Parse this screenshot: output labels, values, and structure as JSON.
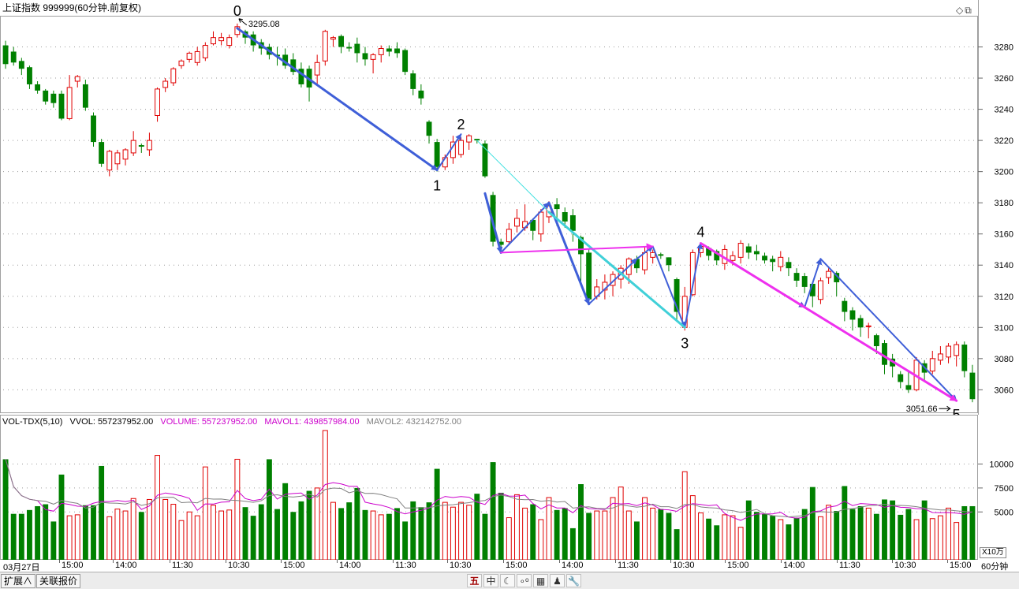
{
  "header": {
    "title": "上证指数 999999(60分钟.前复权)",
    "icons": [
      "diamond-icon",
      "restore-window-icon"
    ]
  },
  "chart_data": [
    {
      "type": "candlestick",
      "title": "上证指数 999999(60分钟.前复权)",
      "ylim": [
        3045,
        3300
      ],
      "yticks": [
        3060,
        3080,
        3100,
        3120,
        3140,
        3160,
        3180,
        3200,
        3220,
        3240,
        3260,
        3280
      ],
      "grid": true,
      "up_color": "#e00000",
      "down_color": "#008000",
      "candles": [
        [
          3281,
          3269,
          3284,
          3266
        ],
        [
          3277,
          3270,
          3280,
          3268
        ],
        [
          3271,
          3266,
          3273,
          3262
        ],
        [
          3267,
          3256,
          3268,
          3253
        ],
        [
          3256,
          3252,
          3258,
          3250
        ],
        [
          3252,
          3245,
          3253,
          3243
        ],
        [
          3250,
          3244,
          3252,
          3241
        ],
        [
          3250,
          3234,
          3252,
          3233
        ],
        [
          3234,
          3254,
          3262,
          3233
        ],
        [
          3258,
          3261,
          3262,
          3254
        ],
        [
          3256,
          3241,
          3259,
          3239
        ],
        [
          3236,
          3219,
          3238,
          3216
        ],
        [
          3219,
          3205,
          3221,
          3203
        ],
        [
          3201,
          3213,
          3214,
          3197
        ],
        [
          3205,
          3212,
          3214,
          3201
        ],
        [
          3208,
          3214,
          3215,
          3204
        ],
        [
          3212,
          3220,
          3226,
          3210
        ],
        [
          3217,
          3216,
          3218,
          3212
        ],
        [
          3214,
          3220,
          3225,
          3210
        ],
        [
          3236,
          3253,
          3254,
          3232
        ],
        [
          3254,
          3258,
          3260,
          3251
        ],
        [
          3257,
          3266,
          3267,
          3255
        ],
        [
          3268,
          3271,
          3272,
          3266
        ],
        [
          3272,
          3276,
          3277,
          3270
        ],
        [
          3270,
          3277,
          3280,
          3268
        ],
        [
          3273,
          3281,
          3283,
          3271
        ],
        [
          3282,
          3286,
          3290,
          3281
        ],
        [
          3284,
          3286,
          3289,
          3281
        ],
        [
          3281,
          3286,
          3288,
          3279
        ],
        [
          3288,
          3293,
          3295,
          3286
        ],
        [
          3290,
          3286,
          3291,
          3282
        ],
        [
          3288,
          3281,
          3290,
          3277
        ],
        [
          3283,
          3279,
          3285,
          3275
        ],
        [
          3280,
          3275,
          3282,
          3272
        ],
        [
          3275,
          3274,
          3280,
          3268
        ],
        [
          3275,
          3268,
          3279,
          3266
        ],
        [
          3272,
          3264,
          3276,
          3262
        ],
        [
          3266,
          3256,
          3270,
          3254
        ],
        [
          3266,
          3254,
          3268,
          3245
        ],
        [
          3262,
          3270,
          3275,
          3255
        ],
        [
          3271,
          3290,
          3291,
          3268
        ],
        [
          3285,
          3286,
          3287,
          3280
        ],
        [
          3287,
          3280,
          3288,
          3276
        ],
        [
          3280,
          3279,
          3283,
          3277
        ],
        [
          3282,
          3276,
          3286,
          3270
        ],
        [
          3276,
          3272,
          3280,
          3268
        ],
        [
          3272,
          3275,
          3276,
          3263
        ],
        [
          3275,
          3279,
          3281,
          3270
        ],
        [
          3279,
          3277,
          3281,
          3274
        ],
        [
          3279,
          3276,
          3283,
          3273
        ],
        [
          3278,
          3264,
          3279,
          3262
        ],
        [
          3263,
          3253,
          3265,
          3249
        ],
        [
          3252,
          3247,
          3256,
          3243
        ],
        [
          3232,
          3223,
          3233,
          3218
        ],
        [
          3219,
          3203,
          3221,
          3200
        ],
        [
          3203,
          3209,
          3211,
          3201
        ],
        [
          3209,
          3219,
          3223,
          3205
        ],
        [
          3211,
          3220,
          3222,
          3209
        ],
        [
          3219,
          3223,
          3224,
          3214
        ],
        [
          3221,
          3220,
          3221,
          3218
        ],
        [
          3218,
          3197,
          3220,
          3196
        ],
        [
          3185,
          3155,
          3187,
          3152
        ],
        [
          3155,
          3153,
          3157,
          3150
        ],
        [
          3155,
          3163,
          3167,
          3153
        ],
        [
          3165,
          3170,
          3176,
          3161
        ],
        [
          3164,
          3168,
          3179,
          3162
        ],
        [
          3169,
          3162,
          3170,
          3156
        ],
        [
          3160,
          3174,
          3176,
          3155
        ],
        [
          3171,
          3178,
          3181,
          3167
        ],
        [
          3179,
          3176,
          3183,
          3165
        ],
        [
          3174,
          3168,
          3177,
          3164
        ],
        [
          3172,
          3162,
          3176,
          3155
        ],
        [
          3158,
          3147,
          3159,
          3128
        ],
        [
          3148,
          3118,
          3150,
          3115
        ],
        [
          3120,
          3126,
          3131,
          3118
        ],
        [
          3124,
          3129,
          3134,
          3118
        ],
        [
          3127,
          3134,
          3136,
          3120
        ],
        [
          3131,
          3138,
          3140,
          3125
        ],
        [
          3134,
          3144,
          3145,
          3128
        ],
        [
          3144,
          3138,
          3146,
          3135
        ],
        [
          3137,
          3148,
          3152,
          3134
        ],
        [
          3145,
          3148,
          3150,
          3141
        ],
        [
          3147,
          3146,
          3148,
          3144
        ],
        [
          3145,
          3140,
          3145,
          3136
        ],
        [
          3131,
          3110,
          3132,
          3104
        ],
        [
          3100,
          3120,
          3126,
          3098
        ],
        [
          3121,
          3148,
          3150,
          3120
        ],
        [
          3148,
          3152,
          3154,
          3145
        ],
        [
          3151,
          3146,
          3152,
          3143
        ],
        [
          3149,
          3143,
          3150,
          3140
        ],
        [
          3141,
          3150,
          3153,
          3137
        ],
        [
          3143,
          3146,
          3149,
          3140
        ],
        [
          3145,
          3154,
          3156,
          3141
        ],
        [
          3152,
          3148,
          3154,
          3144
        ],
        [
          3149,
          3147,
          3153,
          3143
        ],
        [
          3146,
          3143,
          3148,
          3141
        ],
        [
          3144,
          3142,
          3146,
          3136
        ],
        [
          3139,
          3145,
          3149,
          3136
        ],
        [
          3142,
          3138,
          3145,
          3133
        ],
        [
          3135,
          3130,
          3138,
          3126
        ],
        [
          3133,
          3126,
          3135,
          3122
        ],
        [
          3128,
          3120,
          3129,
          3113
        ],
        [
          3118,
          3130,
          3132,
          3115
        ],
        [
          3132,
          3136,
          3138,
          3128
        ],
        [
          3135,
          3129,
          3136,
          3120
        ],
        [
          3117,
          3110,
          3119,
          3104
        ],
        [
          3111,
          3105,
          3113,
          3098
        ],
        [
          3106,
          3100,
          3108,
          3094
        ],
        [
          3101,
          3101,
          3103,
          3093
        ],
        [
          3095,
          3088,
          3096,
          3083
        ],
        [
          3090,
          3076,
          3092,
          3070
        ],
        [
          3080,
          3075,
          3083,
          3068
        ],
        [
          3070,
          3065,
          3072,
          3061
        ],
        [
          3063,
          3060,
          3072,
          3058
        ],
        [
          3060,
          3079,
          3081,
          3059
        ],
        [
          3077,
          3071,
          3079,
          3066
        ],
        [
          3072,
          3080,
          3085,
          3070
        ],
        [
          3079,
          3083,
          3088,
          3076
        ],
        [
          3081,
          3088,
          3090,
          3077
        ],
        [
          3082,
          3089,
          3091,
          3075
        ],
        [
          3089,
          3072,
          3091,
          3068
        ],
        [
          3071,
          3054,
          3076,
          3052
        ]
      ],
      "annotations": [
        {
          "text": "0",
          "x": 29,
          "y": 3298
        },
        {
          "text": "3295.08",
          "x": 29,
          "y": 3295.08
        },
        {
          "text": "1",
          "x": 54,
          "y": 3200
        },
        {
          "text": "2",
          "x": 57,
          "y": 3224
        },
        {
          "text": "3",
          "x": 85,
          "y": 3099
        },
        {
          "text": "4",
          "x": 87,
          "y": 3155
        },
        {
          "text": "3051.66",
          "x": 118,
          "y": 3053
        },
        {
          "text": "5",
          "x": 119,
          "y": 3053
        }
      ],
      "wave_lines": [
        {
          "color": "#3f5fd8",
          "width": 3,
          "arrow": true,
          "points": [
            [
              29,
              3292
            ],
            [
              54,
              3201
            ]
          ]
        },
        {
          "color": "#3f5fd8",
          "width": 2,
          "arrow": true,
          "points": [
            [
              54,
              3201
            ],
            [
              57,
              3224
            ]
          ]
        },
        {
          "color": "#3f5fd8",
          "width": 3,
          "arrow": true,
          "points": [
            [
              60,
              3186
            ],
            [
              62,
              3148
            ]
          ]
        },
        {
          "color": "#3f5fd8",
          "width": 2,
          "arrow": true,
          "points": [
            [
              62,
              3148
            ],
            [
              68,
              3180
            ]
          ]
        },
        {
          "color": "#3f5fd8",
          "width": 3,
          "arrow": true,
          "points": [
            [
              68,
              3180
            ],
            [
              73,
              3115
            ]
          ]
        },
        {
          "color": "#3f5fd8",
          "width": 2,
          "arrow": true,
          "points": [
            [
              73,
              3115
            ],
            [
              79,
              3144
            ]
          ]
        },
        {
          "color": "#3f5fd8",
          "width": 2,
          "arrow": true,
          "points": [
            [
              79,
              3144
            ],
            [
              81,
              3152
            ]
          ]
        },
        {
          "color": "#3f5fd8",
          "width": 2,
          "arrow": true,
          "points": [
            [
              81,
              3152
            ],
            [
              85,
              3100
            ]
          ]
        },
        {
          "color": "#3f5fd8",
          "width": 2,
          "arrow": true,
          "points": [
            [
              85,
              3100
            ],
            [
              87,
              3154
            ]
          ]
        },
        {
          "color": "#6a4fd8",
          "width": 2,
          "arrow": true,
          "points": [
            [
              87,
              3154
            ],
            [
              100,
              3113
            ]
          ]
        },
        {
          "color": "#3f5fd8",
          "width": 2,
          "arrow": true,
          "points": [
            [
              100,
              3113
            ],
            [
              102,
              3144
            ]
          ]
        },
        {
          "color": "#3f5fd8",
          "width": 2,
          "arrow": true,
          "points": [
            [
              102,
              3144
            ],
            [
              119,
              3053
            ]
          ]
        },
        {
          "color": "#40e0e0",
          "width": 1,
          "arrow": false,
          "points": [
            [
              59,
              3220
            ],
            [
              68,
              3174
            ]
          ]
        },
        {
          "color": "#40d0d8",
          "width": 3,
          "arrow": false,
          "points": [
            [
              68,
              3174
            ],
            [
              85,
              3100
            ]
          ]
        },
        {
          "color": "#ee30ee",
          "width": 2,
          "arrow": true,
          "points": [
            [
              62,
              3148
            ],
            [
              81,
              3152
            ]
          ]
        },
        {
          "color": "#ee30ee",
          "width": 3,
          "arrow": true,
          "points": [
            [
              87,
              3154
            ],
            [
              119,
              3053
            ]
          ]
        }
      ]
    },
    {
      "type": "bar",
      "title": "VOL-TDX(5,10)",
      "ylim": [
        0,
        13500
      ],
      "yticks": [
        5000,
        7500,
        10000
      ],
      "unit": "X10万",
      "legend": [
        {
          "text": "VOL-TDX(5,10)",
          "color": "#000000"
        },
        {
          "text": "VVOL: 557237952.00",
          "color": "#000000"
        },
        {
          "text": "VOLUME: 557237952.00",
          "color": "#cc00cc"
        },
        {
          "text": "MAVOL1: 439857984.00",
          "color": "#cc00cc"
        },
        {
          "text": "MAVOL2: 432142752.00",
          "color": "#808080"
        }
      ],
      "values": [
        10500,
        4800,
        4800,
        5200,
        5600,
        5800,
        4000,
        8900,
        4600,
        4700,
        5700,
        5700,
        9800,
        4500,
        5300,
        5100,
        6400,
        5000,
        6300,
        10900,
        6300,
        5800,
        4100,
        5000,
        4600,
        9700,
        5700,
        5100,
        5200,
        10500,
        5500,
        4600,
        5800,
        10500,
        5300,
        8000,
        5000,
        6100,
        7200,
        7500,
        13500,
        6000,
        5400,
        6000,
        7500,
        5200,
        5100,
        4700,
        4800,
        5400,
        4000,
        6100,
        5500,
        6000,
        9500,
        6000,
        5500,
        6000,
        5700,
        6900,
        4800,
        10200,
        7000,
        4400,
        6800,
        5400,
        5800,
        4200,
        6500,
        5200,
        5400,
        3300,
        7900,
        4900,
        5100,
        5100,
        6500,
        7600,
        5100,
        4000,
        6500,
        5400,
        5300,
        4900,
        3200,
        9200,
        6700,
        4900,
        4300,
        3600,
        4700,
        4600,
        3400,
        6200,
        5000,
        4800,
        4600,
        4200,
        3700,
        4400,
        5300,
        7600,
        4500,
        5700,
        5100,
        7700,
        5300,
        5600,
        5400,
        4800,
        6300,
        6200,
        4700,
        5300,
        4200,
        6200,
        4300,
        4600,
        5400,
        3900,
        5600,
        5600
      ]
    }
  ],
  "price_axis": {
    "labels": [
      "3280",
      "3260",
      "3240",
      "3220",
      "3200",
      "3180",
      "3160",
      "3140",
      "3120",
      "3100",
      "3080",
      "3060"
    ]
  },
  "vol_axis": {
    "labels": [
      "10000",
      "7500",
      "5000"
    ],
    "unit": "X10万"
  },
  "time_axis": {
    "labels": [
      "03月27日",
      "15:00",
      "14:00",
      "11:30",
      "10:30",
      "15:00",
      "14:00",
      "11:30",
      "10:30",
      "15:00",
      "14:00",
      "11:30",
      "10:30",
      "15:00",
      "14:00",
      "11:30",
      "10:30",
      "15:00"
    ]
  },
  "period": "60分钟",
  "bottom": {
    "tabs": [
      "扩展∧",
      "关联报价"
    ],
    "toolbar": [
      "五",
      "中",
      "☾",
      "∘ᵒ",
      "▦",
      "♟",
      "🔧"
    ]
  }
}
